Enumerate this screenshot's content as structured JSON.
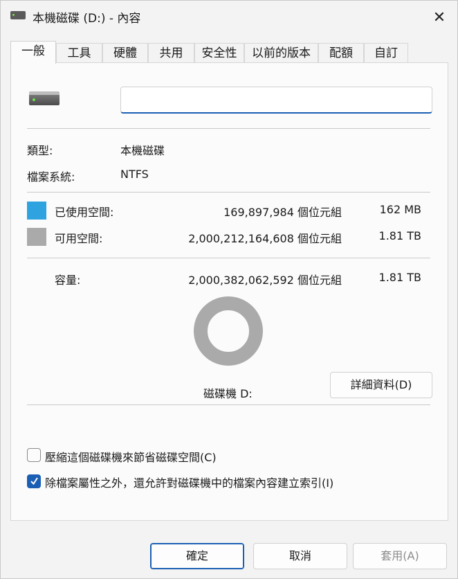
{
  "window": {
    "title": "本機磁碟 (D:) - 內容",
    "close_glyph": "✕"
  },
  "tabs": [
    {
      "label": "一般",
      "active": true
    },
    {
      "label": "工具"
    },
    {
      "label": "硬體"
    },
    {
      "label": "共用"
    },
    {
      "label": "安全性"
    },
    {
      "label": "以前的版本"
    },
    {
      "label": "配額"
    },
    {
      "label": "自訂"
    }
  ],
  "drive": {
    "icon": "drive-icon",
    "name_value": ""
  },
  "info": {
    "type_label": "類型:",
    "type_value": "本機磁碟",
    "fs_label": "檔案系統:",
    "fs_value": "NTFS"
  },
  "usage": {
    "used": {
      "label": "已使用空間:",
      "bytes": "169,897,984 個位元組",
      "size": "162 MB",
      "color": "#2ea3df"
    },
    "free": {
      "label": "可用空間:",
      "bytes": "2,000,212,164,608 個位元組",
      "size": "1.81 TB",
      "color": "#aaaaaa"
    },
    "capacity": {
      "label": "容量:",
      "bytes": "2,000,382,062,592 個位元組",
      "size": "1.81 TB"
    },
    "used_fraction": 0.0001
  },
  "drive_label": "磁碟機 D:",
  "details_button": "詳細資料(D)",
  "options": {
    "compress": {
      "label": "壓縮這個磁碟機來節省磁碟空間(C)",
      "checked": false
    },
    "index": {
      "label": "除檔案屬性之外，還允許對磁碟機中的檔案內容建立索引(I)",
      "checked": true
    }
  },
  "buttons": {
    "ok": "確定",
    "cancel": "取消",
    "apply": "套用(A)"
  }
}
